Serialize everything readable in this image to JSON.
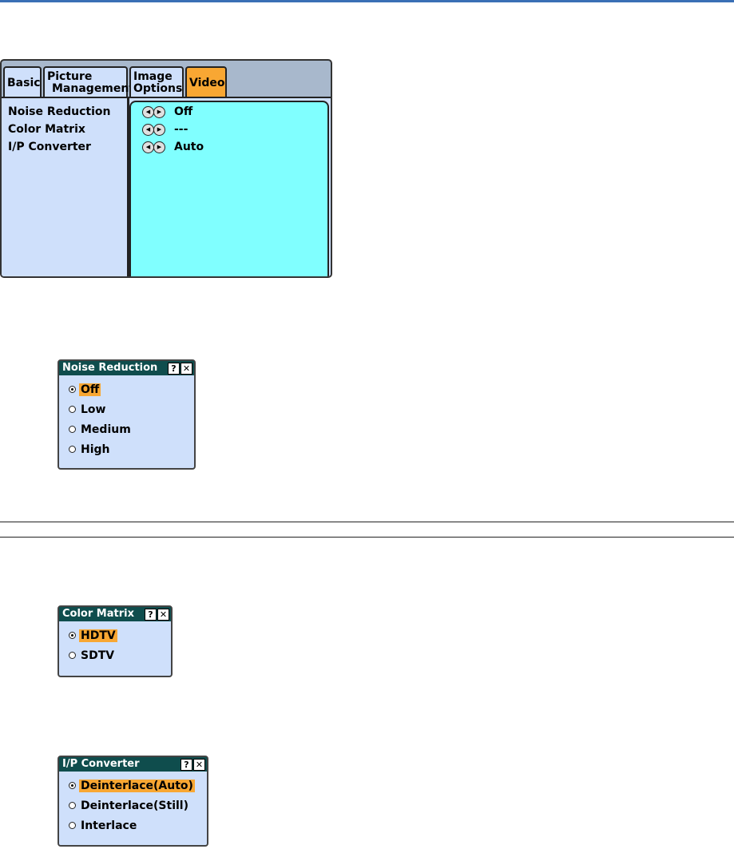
{
  "menu": {
    "tabs": [
      {
        "line1": "Basic",
        "line2": ""
      },
      {
        "line1": "Picture",
        "line2": "Management"
      },
      {
        "line1": "Image",
        "line2": "Options"
      },
      {
        "line1": "Video",
        "line2": ""
      }
    ],
    "active_tab": "Video",
    "items": [
      {
        "label": "Noise Reduction",
        "value": "Off"
      },
      {
        "label": "Color Matrix",
        "value": "---"
      },
      {
        "label": "I/P Converter",
        "value": "Auto"
      }
    ]
  },
  "dialogs": {
    "noise": {
      "title": "Noise Reduction",
      "options": [
        "Off",
        "Low",
        "Medium",
        "High"
      ],
      "selected": "Off"
    },
    "matrix": {
      "title": "Color Matrix",
      "options": [
        "HDTV",
        "SDTV"
      ],
      "selected": "HDTV"
    },
    "ipconv": {
      "title": "I/P Converter",
      "options": [
        "Deinterlace(Auto)",
        "Deinterlace(Still)",
        "Interlace"
      ],
      "selected": "Deinterlace(Auto)"
    }
  },
  "icons": {
    "help": "?",
    "close": "✕",
    "left_arrow": "◀",
    "right_arrow": "▶"
  },
  "colors": {
    "highlight": "#f8a733",
    "value_panel": "#80ffff",
    "title_bar": "#0f4d4d",
    "panel": "#cfe0fb"
  }
}
